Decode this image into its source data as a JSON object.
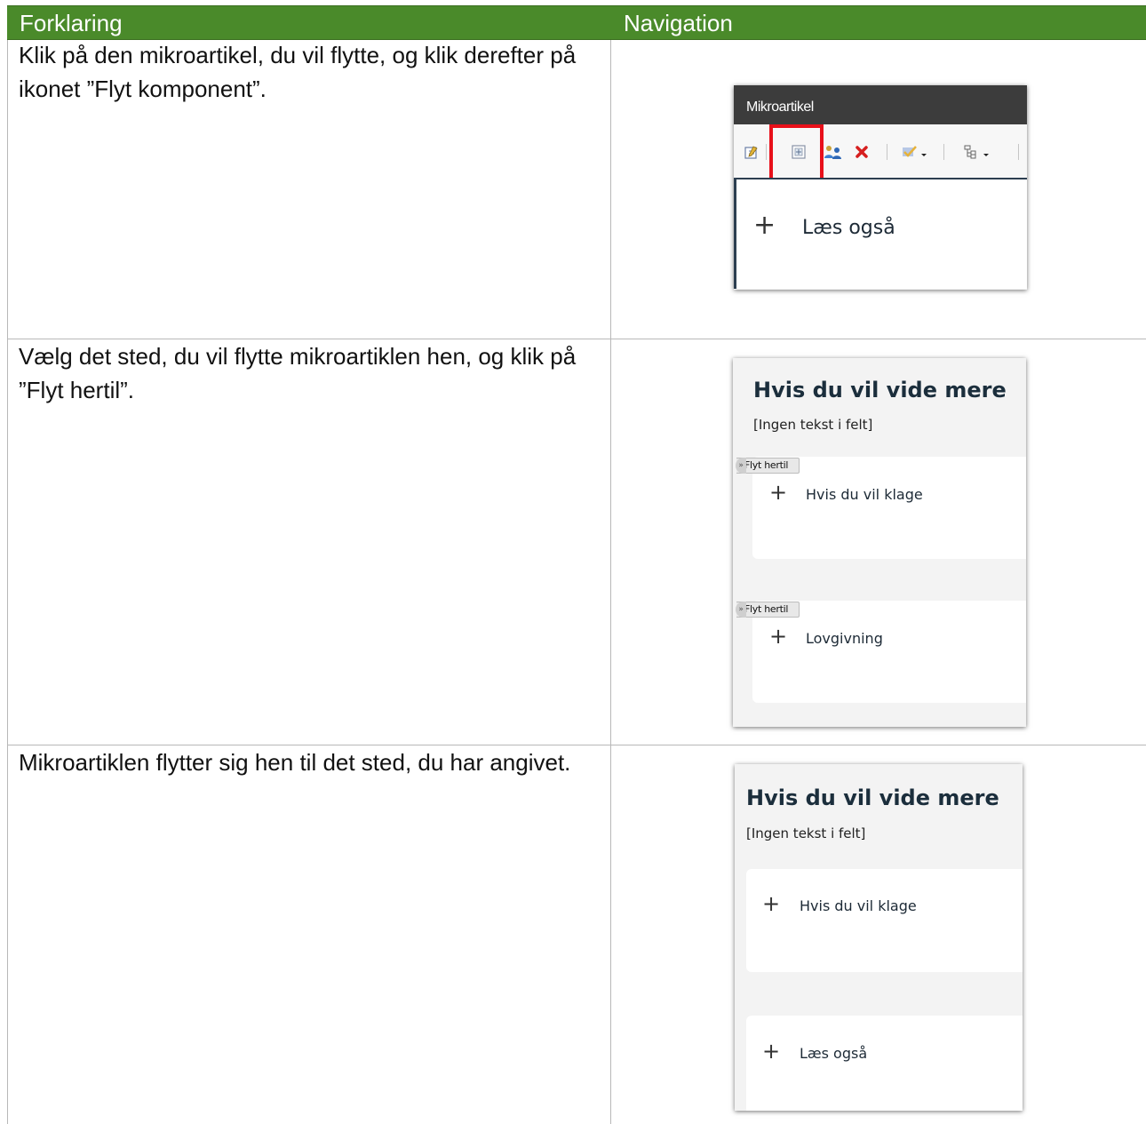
{
  "header": {
    "col1": "Forklaring",
    "col2": "Navigation"
  },
  "rows": [
    {
      "text": "Klik på den mikroartikel, du vil flytte, og klik derefter på ikonet ”Flyt komponent”."
    },
    {
      "text": "Vælg det sted, du vil flytte mikroartiklen hen, og klik på ”Flyt hertil”."
    },
    {
      "text": "Mikroartiklen flytter sig hen til det sted, du har angivet."
    }
  ],
  "shot1": {
    "title": "Mikroartikel",
    "toolbar_icons": [
      "edit-icon",
      "move-component-icon",
      "users-icon",
      "delete-icon",
      "approve-dropdown-icon",
      "structure-dropdown-icon"
    ],
    "highlight_color": "#e8101a",
    "item_label": "Læs også"
  },
  "shot2": {
    "title": "Hvis du vil vide mere",
    "subtitle": "[Ingen tekst i felt]",
    "move_here_label": "Flyt hertil",
    "items": [
      "Hvis du vil klage",
      "Lovgivning"
    ]
  },
  "shot3": {
    "title": "Hvis du vil vide mere",
    "subtitle": "[Ingen tekst i felt]",
    "items": [
      "Hvis du vil klage",
      "Læs også"
    ]
  },
  "colors": {
    "header_bg": "#4a8a2a",
    "header_text": "#ffffff"
  }
}
